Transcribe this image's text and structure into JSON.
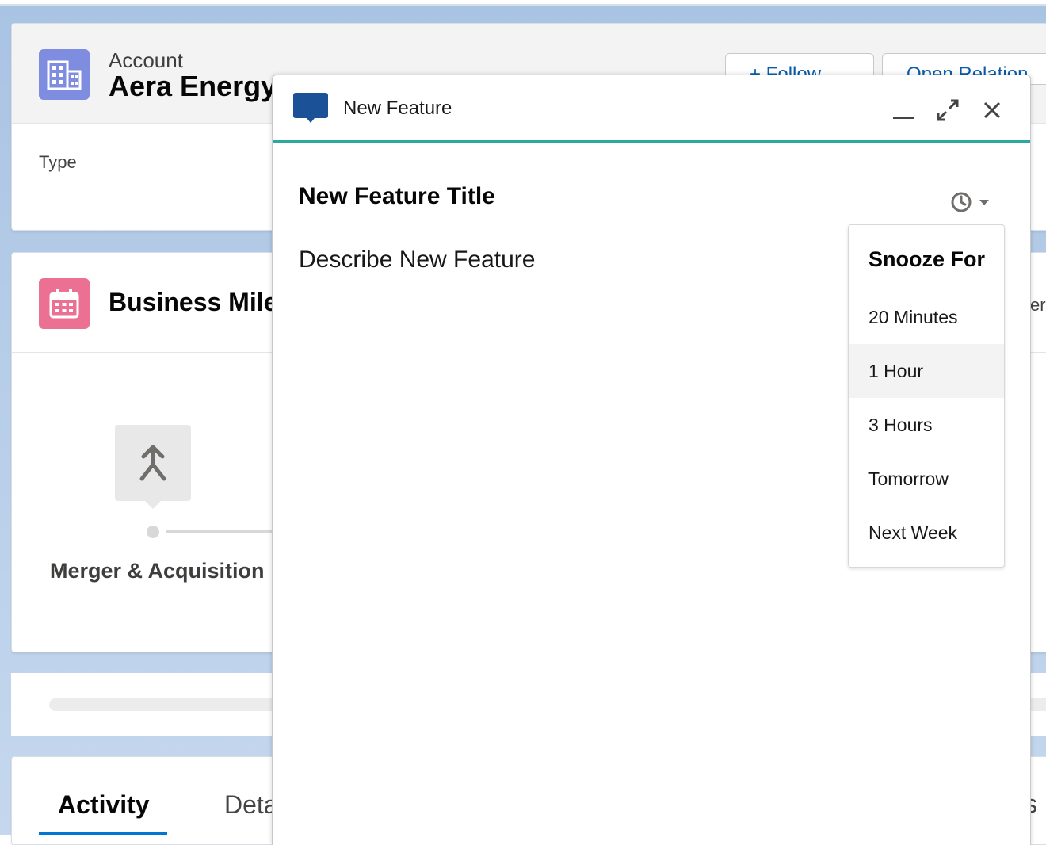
{
  "record": {
    "object_label": "Account",
    "name": "Aera Energy",
    "type_label": "Type",
    "buttons": {
      "follow": "+ Follow",
      "open_relationship": "Open Relation"
    }
  },
  "milestones": {
    "title": "Business Mile",
    "item_label": "Merger & Acquisition",
    "right_peek": "er"
  },
  "tabs": {
    "activity": "Activity",
    "details": "Deta",
    "right_peek": "ls"
  },
  "composer": {
    "title": "New Feature",
    "feature_title": "New Feature Title",
    "feature_description": "Describe New Feature"
  },
  "snooze": {
    "heading": "Snooze For",
    "options": [
      "20 Minutes",
      "1 Hour",
      "3 Hours",
      "Tomorrow",
      "Next Week"
    ],
    "highlighted": "1 Hour"
  },
  "colors": {
    "accent_teal": "#2ea89f",
    "account_icon": "#7f8de1",
    "calendar_icon": "#eb7092",
    "composer_icon": "#1b5297",
    "link_blue": "#0b5cab",
    "tab_underline": "#0176d3"
  },
  "icons": [
    "account-building-icon",
    "calendar-icon",
    "merge-icon",
    "chat-bubble-icon",
    "minimize-icon",
    "expand-icon",
    "close-icon",
    "clock-icon",
    "chevron-down-icon"
  ]
}
